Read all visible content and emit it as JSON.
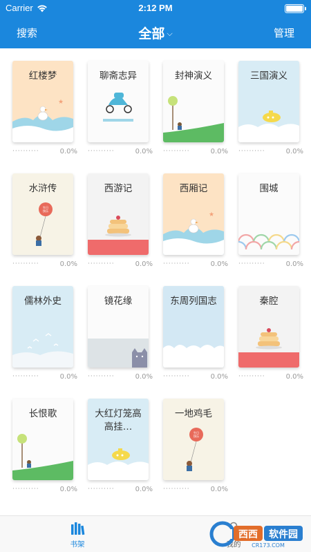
{
  "status": {
    "carrier": "Carrier",
    "time": "2:12 PM"
  },
  "nav": {
    "search": "搜索",
    "title": "全部",
    "manage": "管理"
  },
  "books": [
    {
      "title": "红楼梦",
      "progress": "0.0%",
      "theme": "peach",
      "art": "duck-wave"
    },
    {
      "title": "聊斋志异",
      "progress": "0.0%",
      "theme": "white",
      "art": "scooter"
    },
    {
      "title": "封神演义",
      "progress": "0.0%",
      "theme": "white",
      "art": "tree-hill"
    },
    {
      "title": "三国演义",
      "progress": "0.0%",
      "theme": "blue",
      "art": "submarine"
    },
    {
      "title": "水浒传",
      "progress": "0.0%",
      "theme": "cream",
      "art": "bear-balloon"
    },
    {
      "title": "西游记",
      "progress": "0.0%",
      "theme": "light",
      "art": "cake"
    },
    {
      "title": "西厢记",
      "progress": "0.0%",
      "theme": "peach",
      "art": "duck-wave"
    },
    {
      "title": "围城",
      "progress": "0.0%",
      "theme": "white",
      "art": "scales"
    },
    {
      "title": "儒林外史",
      "progress": "0.0%",
      "theme": "blue",
      "art": "birds"
    },
    {
      "title": "镜花缘",
      "progress": "0.0%",
      "theme": "white",
      "art": "cat"
    },
    {
      "title": "东周列国志",
      "progress": "0.0%",
      "theme": "blue",
      "art": "clouds"
    },
    {
      "title": "秦腔",
      "progress": "0.0%",
      "theme": "light",
      "art": "cake"
    },
    {
      "title": "长恨歌",
      "progress": "0.0%",
      "theme": "white",
      "art": "tree-hill"
    },
    {
      "title": "大红灯笼高高挂…",
      "progress": "0.0%",
      "theme": "blue",
      "art": "submarine"
    },
    {
      "title": "一地鸡毛",
      "progress": "0.0%",
      "theme": "cream",
      "art": "bear-balloon"
    }
  ],
  "progress_dots": "··········",
  "tabbar": {
    "shelf": "书架",
    "mine": "我的"
  },
  "colors": {
    "accent": "#1b87dd",
    "tabbar_bg": "#f8f8f8"
  },
  "watermark": {
    "text": "西西软件园",
    "sub": "CR173.COM"
  }
}
